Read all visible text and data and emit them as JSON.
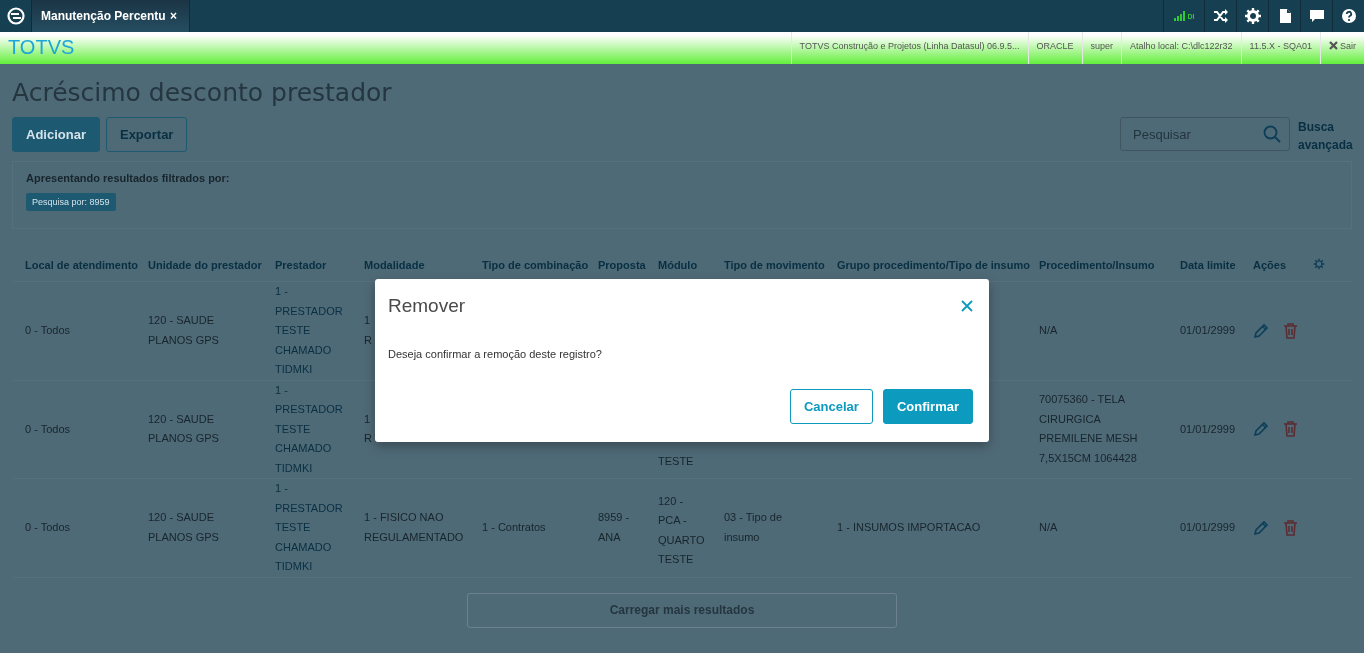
{
  "top_bar": {
    "tab": {
      "label": "Manutenção Percentu",
      "close": "×"
    },
    "signal_label": "DI"
  },
  "header": {
    "brand": "TOTVS",
    "info": [
      "TOTVS Construção e Projetos (Linha Datasul) 06.9.5...",
      "ORACLE",
      "super",
      "Atalho local: C:\\dlc122r32",
      "11.5.X - SQA01"
    ],
    "logout": "Sair"
  },
  "page": {
    "title": "Acréscimo desconto prestador",
    "buttons": [
      {
        "label": "Adicionar",
        "kind": "primary"
      },
      {
        "label": "Exportar",
        "kind": "secondary"
      }
    ],
    "search": {
      "placeholder": "Pesquisar"
    },
    "advanced_search": "Busca avançada",
    "filter": {
      "caption": "Apresentando resultados filtrados por:",
      "tags": [
        "Pesquisa por: 8959"
      ]
    }
  },
  "table": {
    "columns": [
      "Local de atendimento",
      "Unidade do prestador",
      "Prestador",
      "Modalidade",
      "Tipo de combinação",
      "Proposta",
      "Módulo",
      "Tipo de movimento",
      "Grupo procedimento/Tipo de insumo",
      "Procedimento/Insumo",
      "Data limite",
      "Ações"
    ],
    "rows": [
      {
        "local": "0 - Todos",
        "unidade": "120 - SAUDE PLANOS GPS",
        "prestador": "1 - PRESTADOR TESTE CHAMADO TIDMKI",
        "modalidade": "1\nR",
        "procedimento": "N/A",
        "data_limite": "01/01/2999"
      },
      {
        "local": "0 - Todos",
        "unidade": "120 - SAUDE PLANOS GPS",
        "prestador": "1 - PRESTADOR TESTE CHAMADO TIDMKI",
        "modalidade": "1\nR",
        "modulo": "TESTE",
        "procedimento": "70075360 - TELA CIRURGICA PREMILENE MESH 7,5X15CM 1064428",
        "data_limite": "01/01/2999"
      },
      {
        "local": "0 - Todos",
        "unidade": "120 - SAUDE PLANOS GPS",
        "prestador": "1 - PRESTADOR TESTE CHAMADO TIDMKI",
        "modalidade": "1 - FISICO NAO REGULAMENTADO",
        "combinacao": "1 - Contratos",
        "proposta": "8959 - ANA",
        "modulo": "120 - PCA - QUARTO TESTE",
        "movimento": "03 - Tipo de insumo",
        "grupo": "1 - INSUMOS IMPORTACAO",
        "procedimento": "N/A",
        "data_limite": "01/01/2999"
      }
    ]
  },
  "load_more": {
    "label": "Carregar mais resultados",
    "disabled": true
  },
  "dialog": {
    "title": "Remover",
    "message": "Deseja confirmar a remoção deste registro?",
    "buttons": [
      {
        "label": "Cancelar",
        "kind": "secondary"
      },
      {
        "label": "Confirmar",
        "kind": "primary"
      }
    ]
  }
}
